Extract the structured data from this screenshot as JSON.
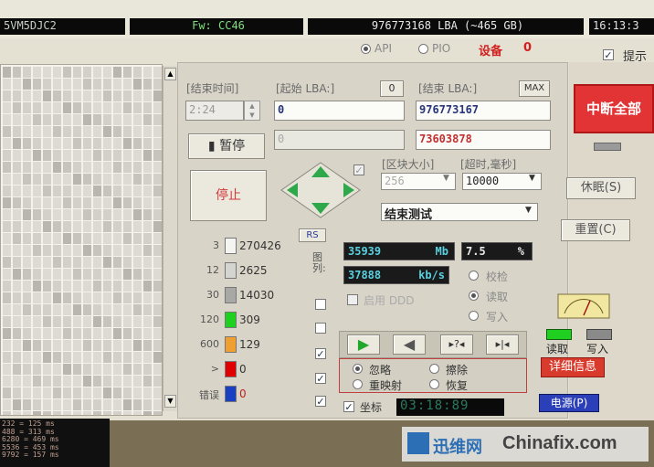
{
  "topbar": {
    "model_fragment": "5VM5DJC2",
    "firmware": "Fw: CC46",
    "capacity": "976773168 LBA (~465 GB)",
    "clock": "16:13:3",
    "mode_api": "API",
    "mode_pio": "PIO",
    "device_label": "设备",
    "device_number": "0",
    "tips_label": "提示"
  },
  "fields": {
    "end_time_label": "[结束时间]",
    "end_time_value": "2:24",
    "start_lba_label": "[起始 LBA:]",
    "start_lba_btn": "0",
    "start_lba_value": "0",
    "end_lba_label": "[结束 LBA:]",
    "end_lba_btn": "MAX",
    "end_lba_value": "976773167",
    "current_lba_value": "73603878",
    "disabled_value": "0",
    "block_size_label": "[区块大小]",
    "block_size_value": "256",
    "timeout_label": "[超时,毫秒]",
    "timeout_value": "10000",
    "end_action_value": "结束测试"
  },
  "buttons": {
    "pause": "暂停",
    "stop": "停止",
    "rs": "RS",
    "abort_all": "中断全部",
    "sleep": "休眠(S)",
    "reset": "重置(C)",
    "details": "详细信息",
    "power": "电源(P)"
  },
  "histogram": [
    {
      "ms": "3",
      "count": "270426",
      "color": "#f4f4f0"
    },
    {
      "ms": "12",
      "count": "2625",
      "color": "#d4d4d0"
    },
    {
      "ms": "30",
      "count": "14030",
      "color": "#a8a8a4"
    },
    {
      "ms": "120",
      "count": "309",
      "color": "#1fd11f"
    },
    {
      "ms": "600",
      "count": "129",
      "color": "#f0a030"
    },
    {
      "ms": ">",
      "count": "0",
      "color": "#e00000"
    },
    {
      "ms": "错误",
      "count": "0",
      "color": "#1840c0"
    }
  ],
  "map_label": "图列:",
  "stats": {
    "mb_value": "35939",
    "mb_unit": "Mb",
    "percent_value": "7.5",
    "percent_unit": "%",
    "speed_value": "37888",
    "speed_unit": "kb/s",
    "ddd_label": "启用 DDD",
    "verify": "校检",
    "read": "读取",
    "write": "写入"
  },
  "actions": {
    "ignore": "忽略",
    "erase": "擦除",
    "remap": "重映射",
    "restore": "恢复"
  },
  "timer": {
    "label": "坐标",
    "value": "03:18:89"
  },
  "indicators": {
    "read_label": "读取",
    "write_label": "写入"
  },
  "log": [
    "232 = 125 ms",
    "488 = 313 ms",
    "6280 = 469 ms",
    "5536 = 453 ms",
    "9792 = 157 ms"
  ],
  "watermark": {
    "cn": "迅维网",
    "en": "Chinafix.com"
  },
  "colors": {
    "abort_red": "#e23434",
    "details_red": "#d83a2c",
    "power_blue": "#2b3fb8",
    "lcd_black": "#0a0a0a"
  }
}
